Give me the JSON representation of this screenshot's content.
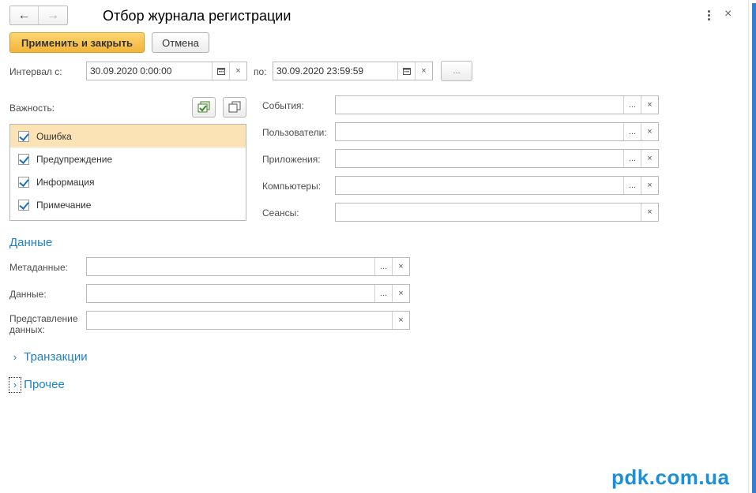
{
  "window": {
    "title": "Отбор журнала регистрации",
    "back_icon": "←",
    "forward_icon": "→",
    "close_icon": "×"
  },
  "toolbar": {
    "apply_label": "Применить и закрыть",
    "cancel_label": "Отмена"
  },
  "interval": {
    "from_label": "Интервал с:",
    "from_value": "30.09.2020  0:00:00",
    "to_label": "по:",
    "to_value": "30.09.2020 23:59:59",
    "choose_label": "..."
  },
  "importance": {
    "label": "Важность:",
    "items": [
      {
        "label": "Ошибка",
        "checked": true,
        "selected": true
      },
      {
        "label": "Предупреждение",
        "checked": true,
        "selected": false
      },
      {
        "label": "Информация",
        "checked": true,
        "selected": false
      },
      {
        "label": "Примечание",
        "checked": true,
        "selected": false
      }
    ]
  },
  "filters": {
    "events_label": "События:",
    "users_label": "Пользователи:",
    "applications_label": "Приложения:",
    "computers_label": "Компьютеры:",
    "sessions_label": "Сеансы:",
    "choose_label": "...",
    "clear_label": "×"
  },
  "data_section": {
    "title": "Данные",
    "metadata_label": "Метаданные:",
    "data_label": "Данные:",
    "presentation_label_1": "Представление",
    "presentation_label_2": "данных:"
  },
  "groups": {
    "transactions": "Транзакции",
    "other": "Прочее",
    "chevron": "›"
  },
  "watermark": "pdk.com.ua",
  "colors": {
    "accent": "#1f80c5",
    "primary_button": "#f3b43a",
    "selected_row": "#fbe3b6"
  }
}
